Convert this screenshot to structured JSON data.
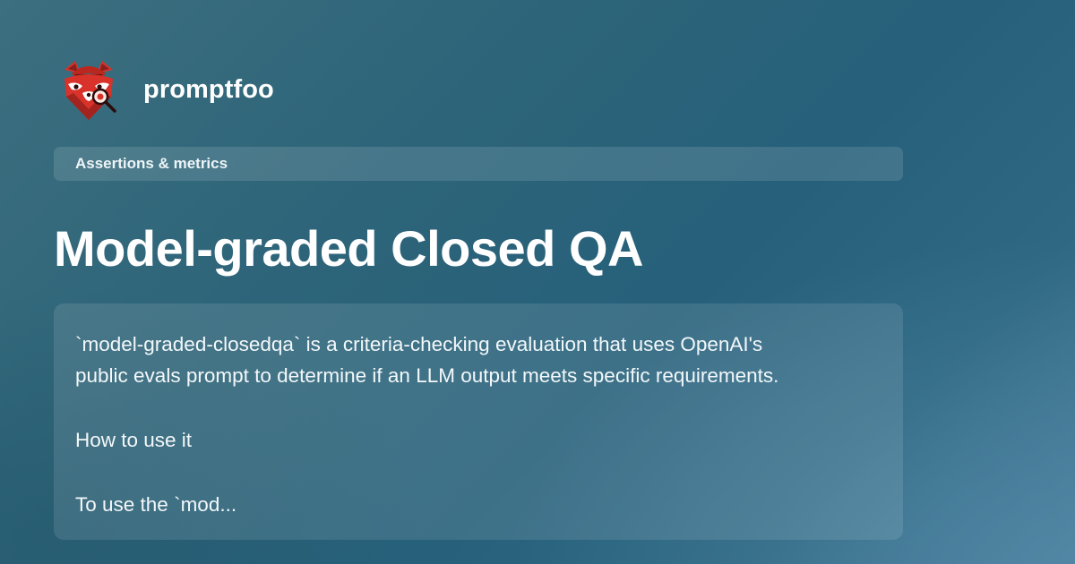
{
  "brand": {
    "name": "promptfoo",
    "logo_icon": "red-panda-detective-logo-icon"
  },
  "category": {
    "label": "Assertions & metrics"
  },
  "page": {
    "title": "Model-graded Closed QA"
  },
  "description": {
    "lines": [
      "`model-graded-closedqa` is a criteria-checking evaluation that uses OpenAI's",
      "public evals prompt to determine if an LLM output meets specific requirements.",
      "How to use it",
      "To use the `mod..."
    ]
  },
  "colors": {
    "background_start": "#3c6f7f",
    "background_mid": "#26607a",
    "background_end": "#4b7f9b",
    "logo_red": "#d8322a",
    "logo_dark_red": "#8a1f1c",
    "text": "#ffffff"
  }
}
